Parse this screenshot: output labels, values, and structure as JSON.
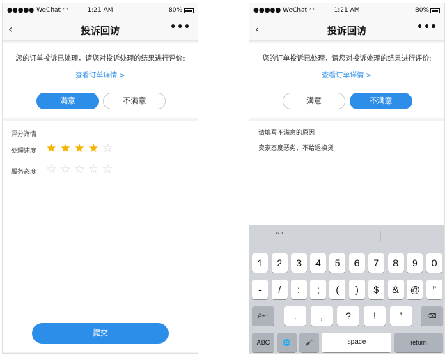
{
  "status_bar": {
    "carrier": "●●●●● WeChat",
    "time": "1:21 AM",
    "battery": "80%"
  },
  "nav": {
    "back": "‹",
    "title": "投诉回访",
    "more": "•••"
  },
  "left_screen": {
    "notice": "您的订单投诉已处理，请您对投诉处理的结果进行评价:",
    "order_link": "查看订单详情 >",
    "satisfied_label": "满意",
    "unsatisfied_label": "不满意",
    "selected": "满意",
    "rating_title": "评分详情",
    "ratings": [
      {
        "label": "处理速度",
        "stars": 4,
        "max": 5
      },
      {
        "label": "服务态度",
        "stars": 0,
        "max": 5
      }
    ],
    "submit_label": "提交"
  },
  "right_screen": {
    "notice": "您的订单投诉已处理，请您对投诉处理的结果进行评价:",
    "order_link": "查看订单详情 >",
    "satisfied_label": "满意",
    "unsatisfied_label": "不满意",
    "selected": "不满意",
    "reason_title": "请填写不满意的原因",
    "reason_text": "卖家态度恶劣，不给退换货",
    "keyboard": {
      "suggestion": "“”",
      "row1": [
        "1",
        "2",
        "3",
        "4",
        "5",
        "6",
        "7",
        "8",
        "9",
        "0"
      ],
      "row2": [
        "-",
        "/",
        ":",
        ";",
        "(",
        ")",
        "$",
        "&",
        "@",
        "”"
      ],
      "row3": [
        "#+=",
        ".",
        ",",
        "?",
        "!",
        "’",
        "⌫"
      ],
      "row4": [
        "ABC",
        "🌐",
        "🎤",
        "space",
        "return"
      ]
    }
  },
  "colors": {
    "accent": "#2c8ee8",
    "star": "#f5b300",
    "star_empty": "#cfcfcf"
  }
}
